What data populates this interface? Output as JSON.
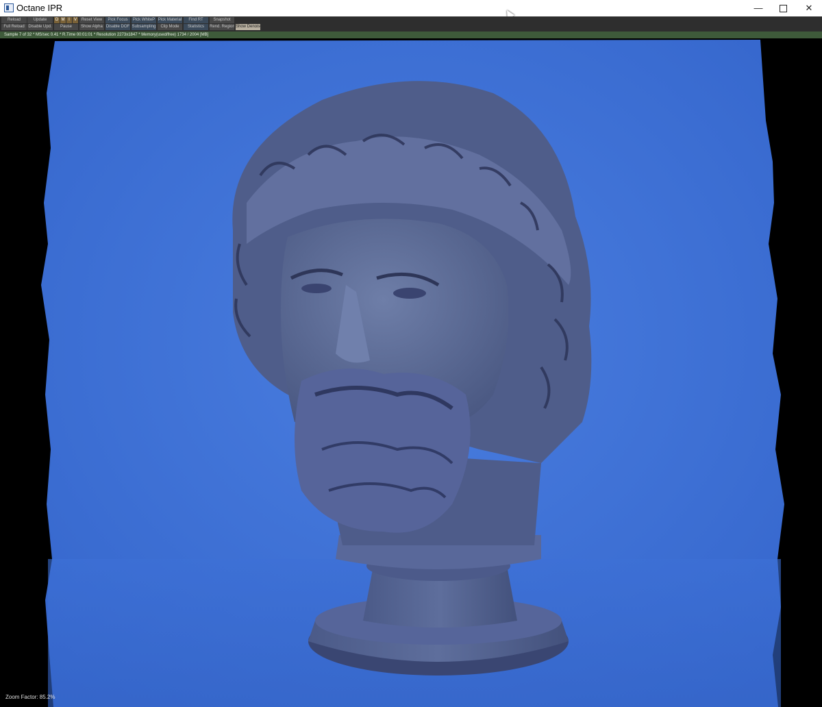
{
  "window": {
    "title": "Octane IPR",
    "controls": {
      "minimize": "—",
      "maximize": "",
      "close": "✕"
    }
  },
  "toolbar": {
    "row1": [
      {
        "label": "Reload"
      },
      {
        "label": "Update"
      },
      {
        "label": "D"
      },
      {
        "label": "M"
      },
      {
        "label": "I"
      },
      {
        "label": "V"
      },
      {
        "label": "Reset View"
      },
      {
        "label": "Pick Focus"
      },
      {
        "label": "Pick WhiteP"
      },
      {
        "label": "Pick Material"
      },
      {
        "label": "Find RT"
      },
      {
        "label": "Snapshot"
      }
    ],
    "row2": [
      {
        "label": "Full Reload"
      },
      {
        "label": "Disable Upd."
      },
      {
        "label": "Pause"
      },
      {
        "label": "Show Alpha"
      },
      {
        "label": "Disable DOF"
      },
      {
        "label": "Subsampling"
      },
      {
        "label": "Clip Mode"
      },
      {
        "label": "Statistics"
      },
      {
        "label": "Rend. Region"
      },
      {
        "label": "Show Denoise"
      }
    ]
  },
  "status": {
    "text": "Sample 7 of 32 * MS/sec 0.41 * R.Time 00:01:01 * Resolution 2273x1847 * Memory(used/free) 1734 / 2004 [MB]"
  },
  "viewport": {
    "zoom_factor": "Zoom Factor: 85.2%",
    "background_color": "#3f73d8",
    "subject": "marble-bust-render"
  },
  "colors": {
    "toolbar_bg": "#2e2e2e",
    "status_bg": "#3e5a3a",
    "render_blue": "#3f73d8",
    "bust_tone": "#5a6a92"
  }
}
